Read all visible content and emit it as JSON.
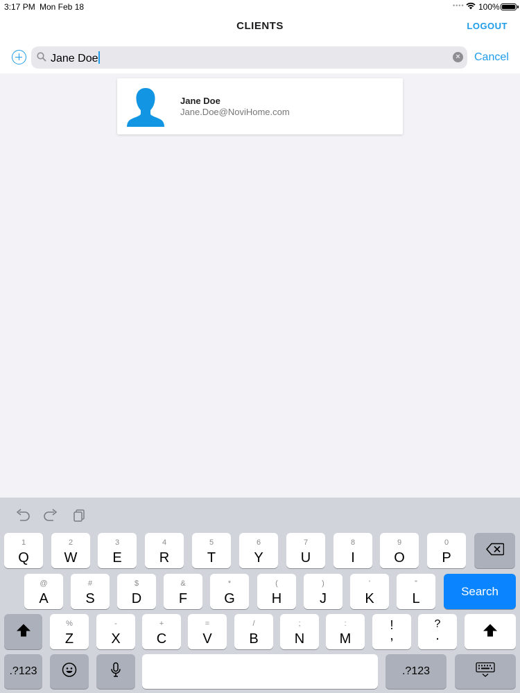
{
  "status_bar": {
    "time": "3:17 PM",
    "date": "Mon Feb 18",
    "battery": "100%"
  },
  "nav": {
    "title": "CLIENTS",
    "logout": "LOGOUT"
  },
  "search": {
    "value": "Jane Doe",
    "cancel": "Cancel",
    "clear_glyph": "×"
  },
  "results": [
    {
      "name": "Jane Doe",
      "email": "Jane.Doe@NoviHome.com"
    }
  ],
  "keyboard": {
    "row1": [
      {
        "sub": "1",
        "main": "Q"
      },
      {
        "sub": "2",
        "main": "W"
      },
      {
        "sub": "3",
        "main": "E"
      },
      {
        "sub": "4",
        "main": "R"
      },
      {
        "sub": "5",
        "main": "T"
      },
      {
        "sub": "6",
        "main": "Y"
      },
      {
        "sub": "7",
        "main": "U"
      },
      {
        "sub": "8",
        "main": "I"
      },
      {
        "sub": "9",
        "main": "O"
      },
      {
        "sub": "0",
        "main": "P"
      }
    ],
    "row2": [
      {
        "sub": "@",
        "main": "A"
      },
      {
        "sub": "#",
        "main": "S"
      },
      {
        "sub": "$",
        "main": "D"
      },
      {
        "sub": "&",
        "main": "F"
      },
      {
        "sub": "*",
        "main": "G"
      },
      {
        "sub": "(",
        "main": "H"
      },
      {
        "sub": ")",
        "main": "J"
      },
      {
        "sub": "’",
        "main": "K"
      },
      {
        "sub": "”",
        "main": "L"
      }
    ],
    "row3": [
      {
        "sub": "%",
        "main": "Z"
      },
      {
        "sub": "-",
        "main": "X"
      },
      {
        "sub": "+",
        "main": "C"
      },
      {
        "sub": "=",
        "main": "V"
      },
      {
        "sub": "/",
        "main": "B"
      },
      {
        "sub": ";",
        "main": "N"
      },
      {
        "sub": ":",
        "main": "M"
      },
      {
        "sub": "!",
        "main": ","
      },
      {
        "sub": "?",
        "main": "."
      }
    ],
    "search_key": "Search",
    "numbers_key": ".?123"
  }
}
